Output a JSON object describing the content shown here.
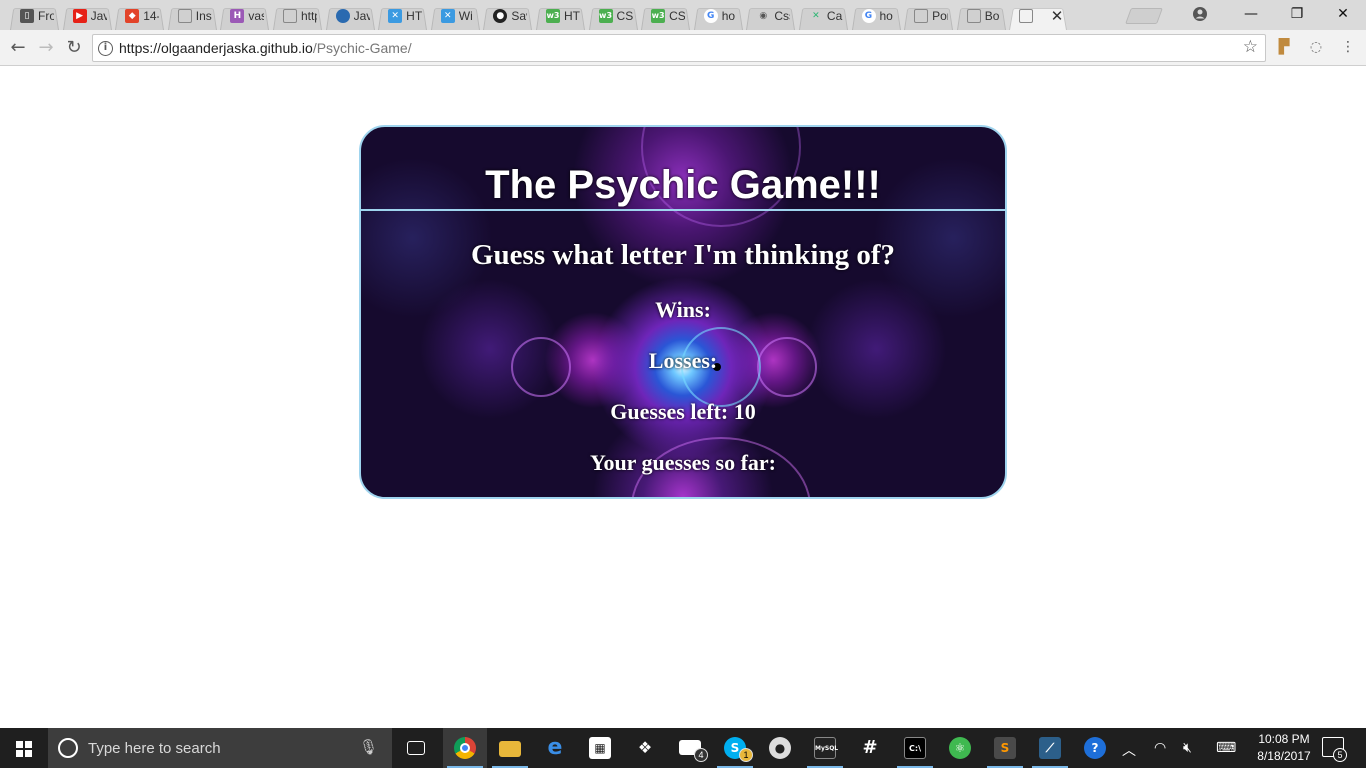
{
  "browser": {
    "tabs": [
      {
        "title": "Fro",
        "icon": "book-icon",
        "color": "#555555"
      },
      {
        "title": "Jav",
        "icon": "youtube-icon",
        "color": "#e62117"
      },
      {
        "title": "14-",
        "icon": "gitlab-icon",
        "color": "#e24329"
      },
      {
        "title": "Inst",
        "icon": "page-icon",
        "color": "#888888"
      },
      {
        "title": "vas",
        "icon": "h-icon",
        "color": "#9b59b6"
      },
      {
        "title": "http",
        "icon": "page-icon",
        "color": "#888888"
      },
      {
        "title": "Jav",
        "icon": "globe-icon",
        "color": "#2a6ab0"
      },
      {
        "title": "HT",
        "icon": "x-icon",
        "color": "#3b9ae1"
      },
      {
        "title": "Wi",
        "icon": "x-icon",
        "color": "#3b9ae1"
      },
      {
        "title": "Sav",
        "icon": "github-icon",
        "color": "#222222"
      },
      {
        "title": "HT",
        "icon": "w3-icon",
        "color": "#4caf50"
      },
      {
        "title": "CS",
        "icon": "w3-icon",
        "color": "#4caf50"
      },
      {
        "title": "CS",
        "icon": "w3-icon",
        "color": "#4caf50"
      },
      {
        "title": "ho",
        "icon": "google-icon",
        "color": "#4285f4"
      },
      {
        "title": "Css",
        "icon": "eye-icon",
        "color": "#555555"
      },
      {
        "title": "Cal",
        "icon": "pinwheel-icon",
        "color": "#2bb673"
      },
      {
        "title": "ho",
        "icon": "google-icon",
        "color": "#4285f4"
      },
      {
        "title": "Por",
        "icon": "page-icon",
        "color": "#888888"
      },
      {
        "title": "Bo",
        "icon": "page-icon",
        "color": "#888888"
      },
      {
        "title": "",
        "icon": "page-icon",
        "color": "#888888",
        "active": true
      }
    ],
    "url_host": "https://olgaanderjaska.github.io",
    "url_path": "/Psychic-Game/"
  },
  "game": {
    "title": "The Psychic Game!!!",
    "question": "Guess what letter I'm thinking of?",
    "wins_label": "Wins:",
    "losses_label": "Losses:",
    "guesses_left_label": "Guesses left: 10",
    "guesses_so_far_label": "Your guesses so far:"
  },
  "taskbar": {
    "search_placeholder": "Type here to search",
    "time": "10:08 PM",
    "date": "8/18/2017",
    "notification_count": "5",
    "mail_badge": "4",
    "skype_badge": "1"
  },
  "colors": {
    "frame_border": "#9fd4ee",
    "game_background": "#160a2e",
    "taskbar": "#1f1f1f"
  }
}
